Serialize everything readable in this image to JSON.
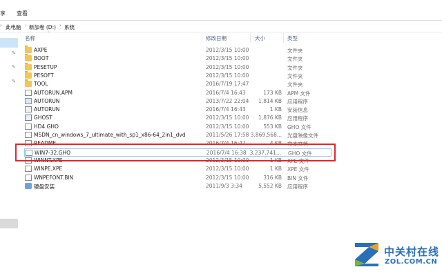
{
  "ribbon": {
    "tab_share": "享",
    "tab_view": "查看"
  },
  "address": {
    "crumbs": [
      "此电脑",
      "新加卷 (D:)",
      "系统"
    ],
    "separator": "›"
  },
  "columns": {
    "name": "名称",
    "date": "修改日期",
    "size": "大小",
    "type": "类型"
  },
  "files": [
    {
      "name": "AXPE",
      "date": "2012/3/15 10:00",
      "size": "",
      "type": "文件夹",
      "icon": "folder-icon"
    },
    {
      "name": "BOOT",
      "date": "2012/3/15 10:00",
      "size": "",
      "type": "文件夹",
      "icon": "folder-icon"
    },
    {
      "name": "PESETUP",
      "date": "2012/3/15 10:00",
      "size": "",
      "type": "文件夹",
      "icon": "folder-icon"
    },
    {
      "name": "PESOFT",
      "date": "2012/3/15 10:00",
      "size": "",
      "type": "文件夹",
      "icon": "folder-icon"
    },
    {
      "name": "TOOL",
      "date": "2016/7/19 17:47",
      "size": "",
      "type": "文件夹",
      "icon": "folder-icon"
    },
    {
      "name": "AUTORUN.APM",
      "date": "2016/7/4 16:43",
      "size": "173 KB",
      "type": "APM 文件",
      "icon": "file-icon"
    },
    {
      "name": "AUTORUN",
      "date": "2013/7/22 22:04",
      "size": "1,814 KB",
      "type": "应用程序",
      "icon": "exe-icon"
    },
    {
      "name": "AUTORUN",
      "date": "2016/7/4 16:43",
      "size": "1 KB",
      "type": "安装信息",
      "icon": "config-icon"
    },
    {
      "name": "GHOST",
      "date": "2012/3/15 10:00",
      "size": "1,876 KB",
      "type": "应用程序",
      "icon": "ghost-icon"
    },
    {
      "name": "HD4.GHO",
      "date": "2012/3/15 10:00",
      "size": "553 KB",
      "type": "GHO 文件",
      "icon": "file-icon"
    },
    {
      "name": "MSDN_cn_windows_7_ultimate_with_sp1_x86-64_2in1_dvd",
      "date": "2011/5/26 17:58",
      "size": "3,869,568...",
      "type": "光盘映像文件",
      "icon": "disc-image-icon"
    },
    {
      "name": "README",
      "date": "2016/7/4 16:42",
      "size": "4 KB",
      "type": "文本文档",
      "icon": "file-icon"
    },
    {
      "name": "WIN7-32.GHO",
      "date": "2016/7/4 16:38",
      "size": "3,237,741...",
      "type": "GHO 文件",
      "icon": "file-icon"
    },
    {
      "name": "WINNT.XPE",
      "date": "2012/3/15 10:00",
      "size": "1 KB",
      "type": "XPE 文件",
      "icon": "file-icon"
    },
    {
      "name": "WINPE.XPE",
      "date": "2012/3/15 10:00",
      "size": "1 KB",
      "type": "XPE 文件",
      "icon": "file-icon"
    },
    {
      "name": "WNPEFONT.BIN",
      "date": "2012/3/15 10:00",
      "size": "316 KB",
      "type": "BIN 文件",
      "icon": "file-icon"
    },
    {
      "name": "硬盘安装",
      "date": "2011/9/3 3:34",
      "size": "5,552 KB",
      "type": "应用程序",
      "icon": "disk-install-icon"
    }
  ],
  "watermark": {
    "cn": "中关村在线",
    "en": "ZOL.COM.CN"
  },
  "colors": {
    "highlight_border": "#e4262b",
    "folder": "#f2c757",
    "watermark": "#2b6fb8",
    "header_text": "#4d6185"
  }
}
